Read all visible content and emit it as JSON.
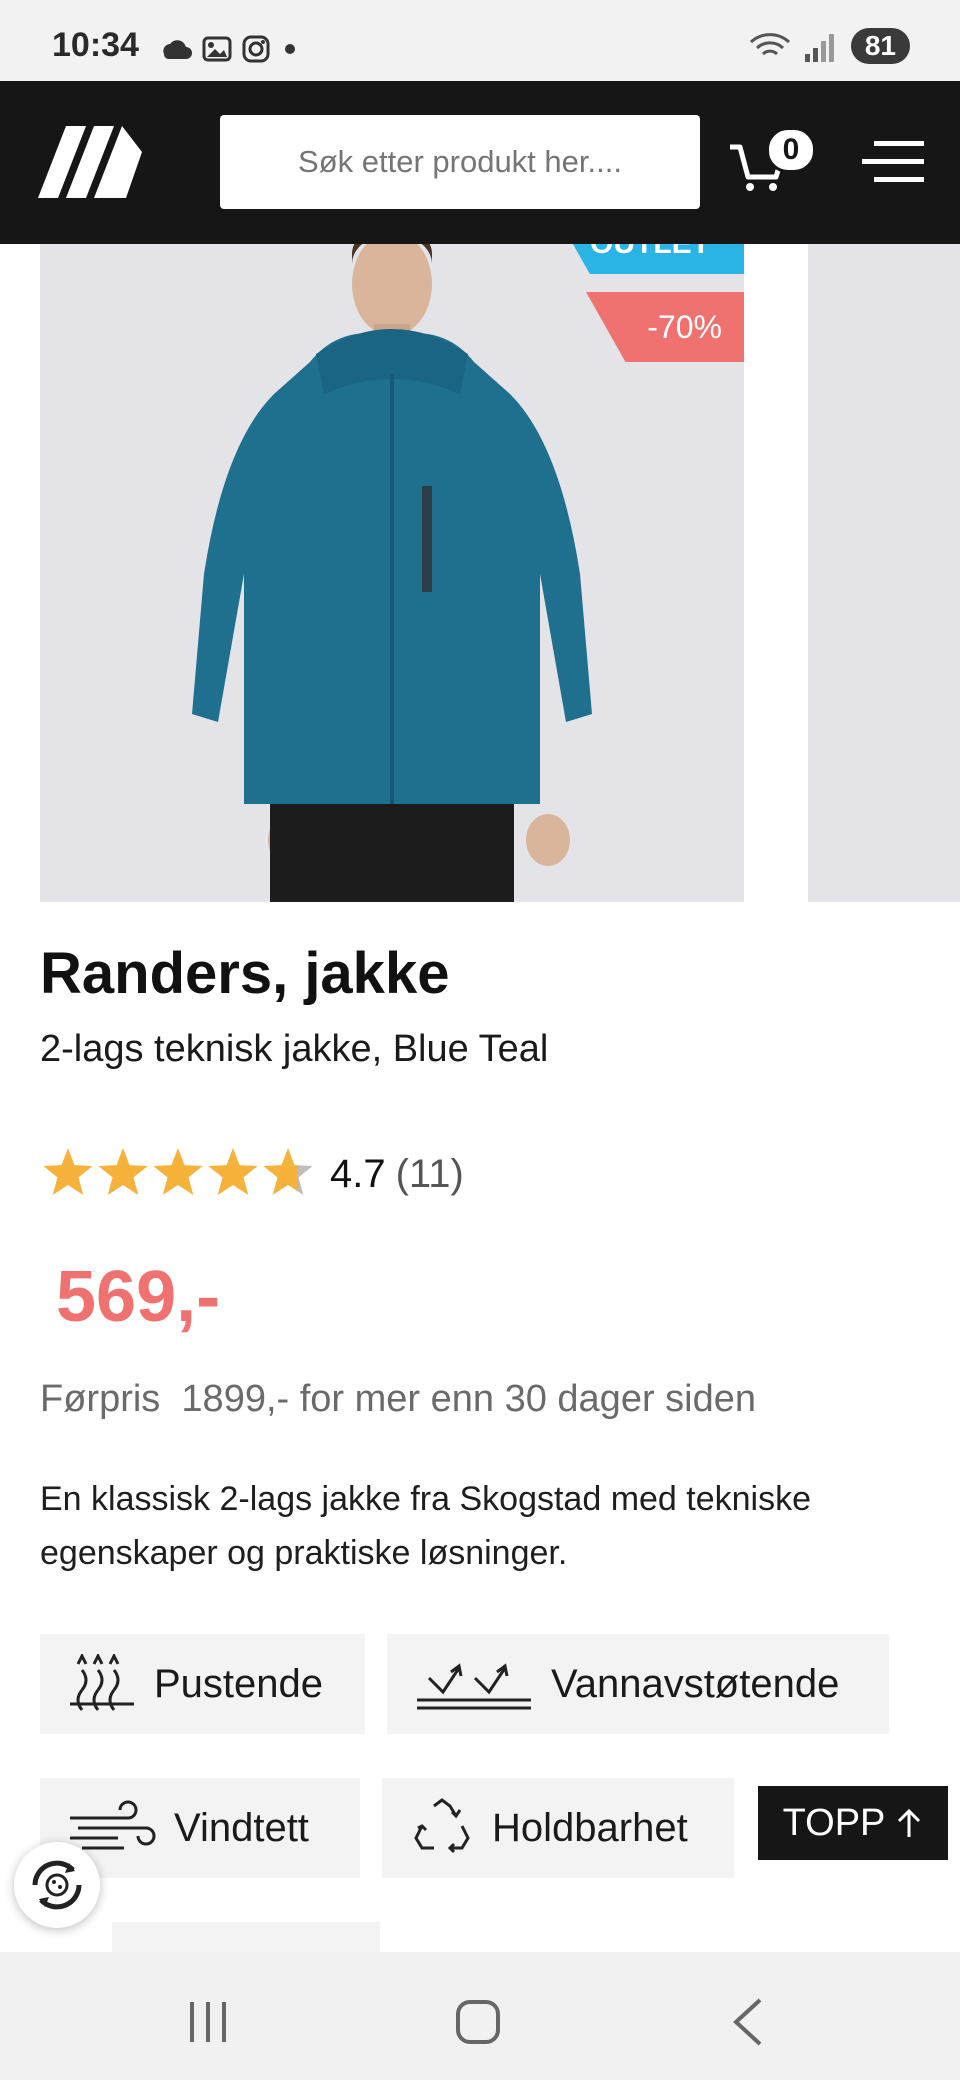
{
  "status": {
    "time": "10:34",
    "battery": "81"
  },
  "header": {
    "search_placeholder": "Søk etter produkt her....",
    "cart_count": "0"
  },
  "product": {
    "badge_outlet": "OUTLET",
    "badge_discount": "-70%",
    "title": "Randers, jakke",
    "subtitle": "2-lags teknisk jakke, Blue Teal",
    "rating_value": "4.7",
    "rating_count": "(11)",
    "rating_stars": 4.7,
    "price": "569,-",
    "before_price": "Førpris  1899,- for mer enn 30 dager siden",
    "description": "En klassisk 2-lags jakke fra Skogstad med tekniske egenskaper og praktiske løsninger."
  },
  "features": [
    {
      "label": "Pustende",
      "icon": "breathable-icon"
    },
    {
      "label": "Vannavstøtende",
      "icon": "water-repellent-icon"
    },
    {
      "label": "Vindtett",
      "icon": "windproof-icon"
    },
    {
      "label": "Holdbarhet",
      "icon": "recycle-icon"
    }
  ],
  "scroll_top_label": "TOPP",
  "colors": {
    "header_bg": "#161616",
    "sale_red": "#f07270",
    "outlet_blue": "#2ab3e5",
    "star": "#f6b23b",
    "jacket": "#1f6f8f"
  }
}
